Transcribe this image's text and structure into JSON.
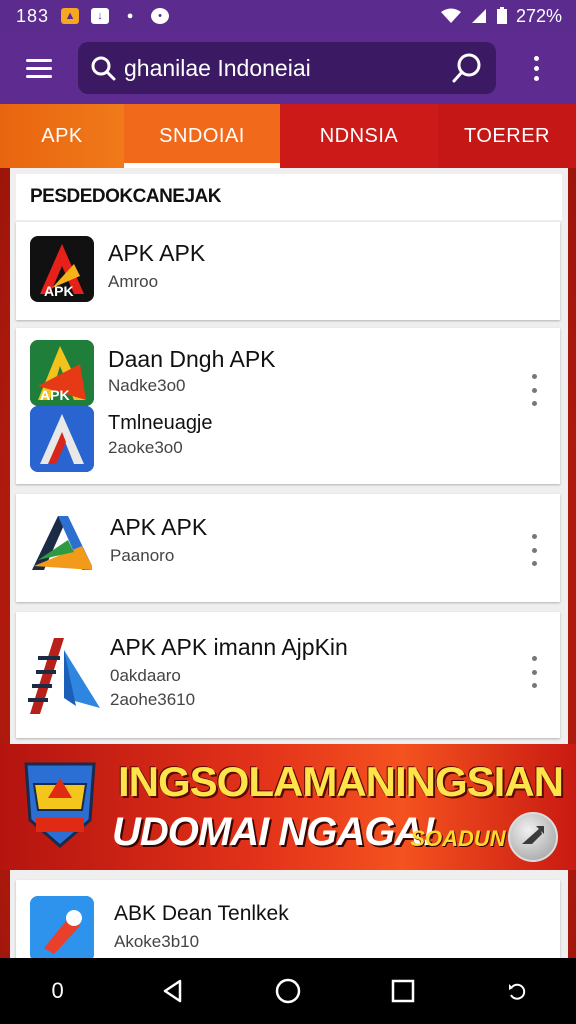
{
  "status_bar": {
    "time": "183",
    "battery": "272%"
  },
  "app_bar": {
    "search_text": "ghanilae Indoneiai"
  },
  "tabs": [
    {
      "label": "APK"
    },
    {
      "label": "SNDOIAI"
    },
    {
      "label": "NDNSIA"
    },
    {
      "label": "TOERER"
    }
  ],
  "section": {
    "title": "PESDEDOKCANEJAK"
  },
  "apps": [
    {
      "name": "APK APK",
      "sub1": "Amroo"
    },
    {
      "name": "Daan Dngh APK",
      "sub1": "Nadke3o0",
      "sub2_name": "Tmlneuagje",
      "sub2": "2aoke3o0"
    },
    {
      "name": "APK APK",
      "sub1": "Paanoro"
    },
    {
      "name": "APK APK imann AjpKin",
      "sub1": "0akdaaro",
      "sub2": "2aohe3610"
    },
    {
      "name": "ABK Dean Tenlkek",
      "sub1": "Akoke3b10"
    }
  ],
  "banner": {
    "line1": "INGSOLAMANINGSIAN",
    "line2": "UDOMAI NGAGA!",
    "cta": "SOADUN"
  },
  "navbar": {
    "left_label": "0"
  },
  "colors": {
    "purple": "#5e2b91",
    "search_bg": "#3b1a63",
    "orange": "#f16a1b",
    "red": "#c51715",
    "banner_yellow": "#ffe34a"
  }
}
